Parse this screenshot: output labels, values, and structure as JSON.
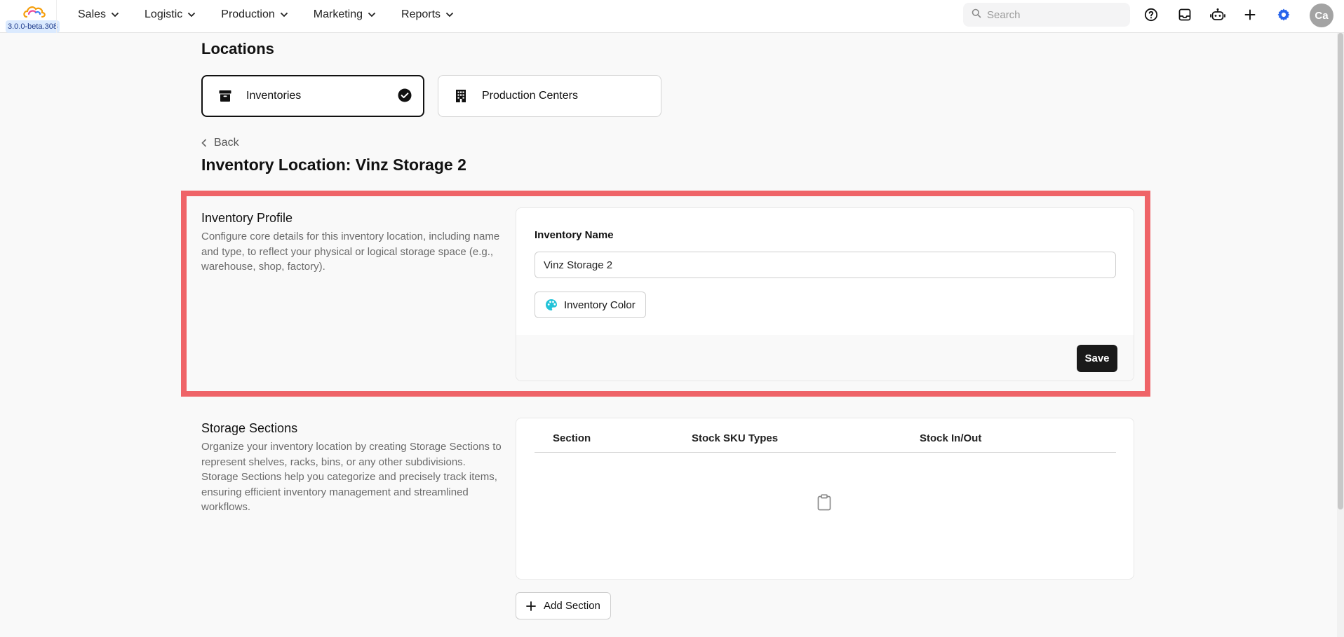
{
  "app": {
    "version": "3.0.0-beta.308"
  },
  "nav": [
    {
      "label": "Sales"
    },
    {
      "label": "Logistic"
    },
    {
      "label": "Production"
    },
    {
      "label": "Marketing"
    },
    {
      "label": "Reports"
    }
  ],
  "search": {
    "placeholder": "Search",
    "value": ""
  },
  "toolbar_icons": [
    "help-circle-icon",
    "inbox-icon",
    "robot-icon",
    "plus-icon",
    "gear-icon"
  ],
  "user": {
    "initials": "Ca"
  },
  "page": {
    "title": "Locations"
  },
  "location_tabs": [
    {
      "label": "Inventories",
      "icon": "archive-box-icon",
      "selected": true
    },
    {
      "label": "Production Centers",
      "icon": "building-icon",
      "selected": false
    }
  ],
  "back": {
    "label": "Back"
  },
  "detail": {
    "title": "Inventory Location: Vinz Storage 2"
  },
  "profile": {
    "title": "Inventory Profile",
    "description": "Configure core details for this inventory location, including name and type, to reflect your physical or logical storage space (e.g., warehouse, shop, factory).",
    "name_label": "Inventory Name",
    "name_value": "Vinz Storage 2",
    "color_button": "Inventory Color",
    "save": "Save"
  },
  "storage": {
    "title": "Storage Sections",
    "description": "Organize your inventory location by creating Storage Sections to represent shelves, racks, bins, or any other subdivisions. Storage Sections help you categorize and precisely track items, ensuring efficient inventory management and streamlined workflows.",
    "columns": [
      "Section",
      "Stock SKU Types",
      "Stock In/Out"
    ],
    "rows": [],
    "add_button": "Add Section"
  },
  "colors": {
    "accent": "#2563eb",
    "highlight": "#ef6468",
    "primary_button": "#1a1a1a",
    "version_badge": "#dbeafe"
  }
}
